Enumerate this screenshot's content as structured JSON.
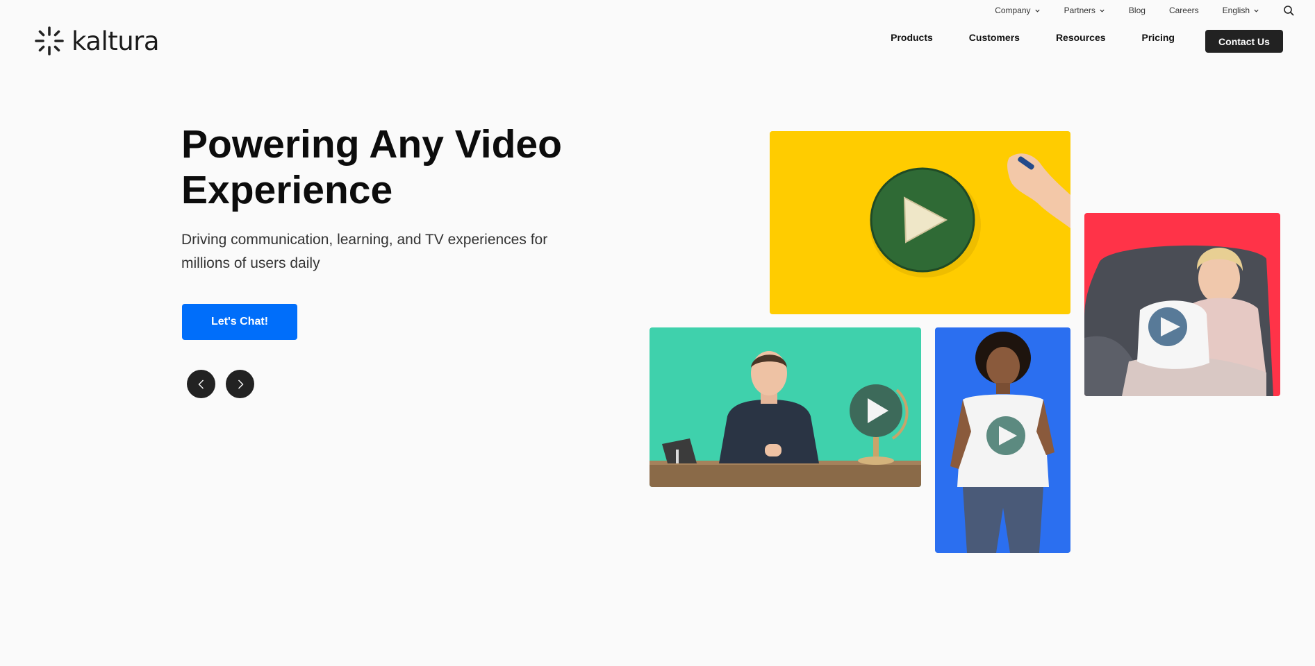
{
  "utility_nav": {
    "company": "Company",
    "partners": "Partners",
    "blog": "Blog",
    "careers": "Careers",
    "language": "English"
  },
  "header": {
    "logo_text": "kaltura",
    "nav": [
      "Products",
      "Customers",
      "Resources",
      "Pricing"
    ],
    "contact_label": "Contact Us"
  },
  "hero": {
    "title": "Powering Any Video Experience",
    "subtitle": "Driving communication, learning, and TV experiences for millions of users daily",
    "cta_label": "Let's Chat!"
  },
  "tiles": {
    "yellow": {
      "color": "#ffcc00",
      "icon": "play-icon"
    },
    "green": {
      "color": "#3fd1ac",
      "icon": "play-icon"
    },
    "blue": {
      "color": "#2b6ff0",
      "icon": "play-icon"
    },
    "red": {
      "color": "#ff3348",
      "icon": "play-icon"
    }
  },
  "colors": {
    "accent": "#006efa",
    "dark_button": "#222222",
    "background": "#fafafa"
  }
}
